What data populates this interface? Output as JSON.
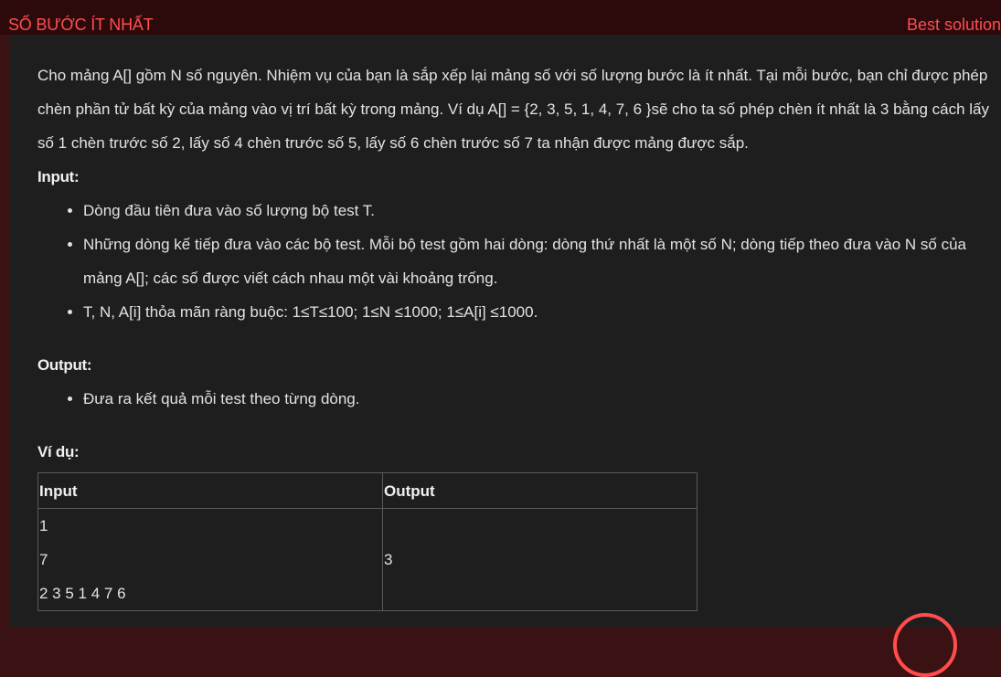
{
  "header": {
    "title": "SỐ BƯỚC ÍT NHẤT",
    "best_solution_label": "Best solution"
  },
  "problem": {
    "description": "Cho mảng A[] gồm N số nguyên. Nhiệm vụ của bạn là sắp xếp lại mảng số với số lượng bước là ít nhất. Tại mỗi bước, bạn chỉ được phép chèn phần tử bất kỳ của mảng vào vị trí bất kỳ trong mảng. Ví dụ A[] = {2, 3, 5, 1, 4, 7, 6 }sẽ cho ta số phép chèn ít nhất là 3 bằng cách lấy số 1 chèn trước số 2, lấy số 4 chèn trước số 5, lấy số 6 chèn trước số 7 ta nhận được mảng được sắp.",
    "input_heading": "Input:",
    "input_items": [
      "Dòng đầu tiên đưa vào số lượng bộ test T.",
      "Những dòng kế tiếp đưa vào các bộ test. Mỗi bộ test gồm hai dòng: dòng thứ nhất là một số N; dòng tiếp theo đưa vào N số của mảng A[]; các số được viết cách nhau một vài khoảng trống.",
      "T, N, A[i] thỏa mãn ràng buộc: 1≤T≤100;  1≤N ≤1000; 1≤A[i] ≤1000."
    ],
    "output_heading": "Output:",
    "output_items": [
      "Đưa ra kết quả mỗi test theo từng dòng."
    ],
    "example_heading": "Ví dụ:",
    "example_table": {
      "headers": [
        "Input",
        "Output"
      ],
      "input_lines": [
        "1",
        "7",
        "2 3 5 1 4 7 6"
      ],
      "output_value": "3"
    }
  },
  "colors": {
    "accent": "#ff4d4d",
    "panel_bg": "#1e1e1e",
    "frame_bg": "#3a1214"
  }
}
